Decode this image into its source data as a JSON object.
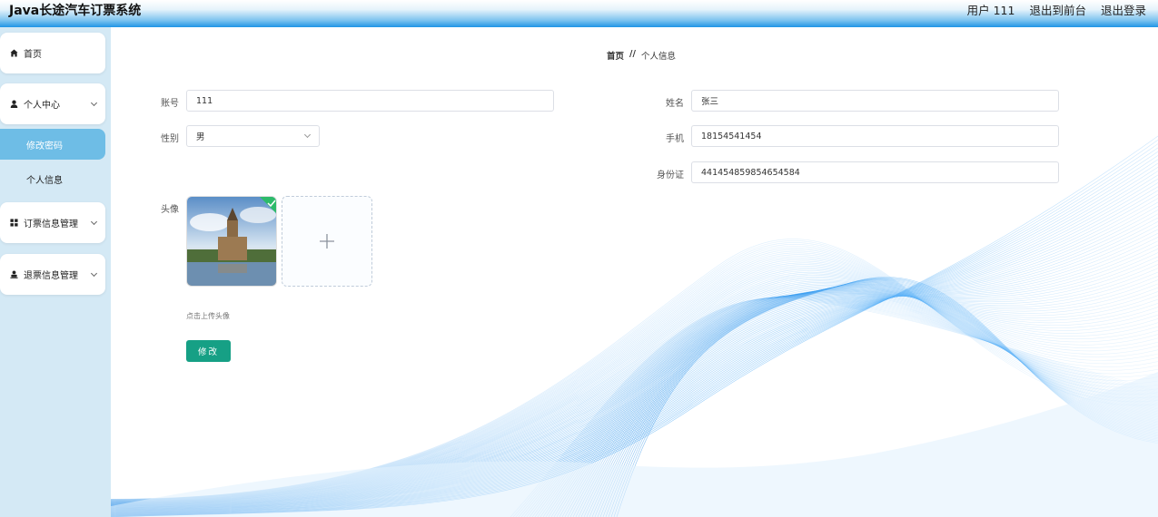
{
  "app": {
    "title": "Java长途汽车订票系统",
    "user_label": "用户 111",
    "back_to_front": "退出到前台",
    "logout": "退出登录"
  },
  "sidebar": {
    "home": "首页",
    "personal_center": "个人中心",
    "change_password": "修改密码",
    "personal_info": "个人信息",
    "ticket_management": "订票信息管理",
    "refund_management": "退票信息管理"
  },
  "breadcrumb": {
    "home": "首页",
    "separator": "//",
    "current": "个人信息"
  },
  "form": {
    "account_label": "账号",
    "account_value": "111",
    "gender_label": "性别",
    "gender_value": "男",
    "name_label": "姓名",
    "name_value": "张三",
    "phone_label": "手机",
    "phone_value": "18154541454",
    "id_label": "身份证",
    "id_value": "441454859854654584",
    "avatar_label": "头像",
    "upload_hint": "点击上传头像",
    "submit_label": "修改"
  },
  "icons": {
    "home": "home-icon",
    "user": "user-icon",
    "grid": "grid-icon",
    "person": "person-icon",
    "chevron": "chevron-down-icon",
    "plus": "plus-icon",
    "check": "check-icon"
  },
  "colors": {
    "accent": "#6ebde6",
    "button": "#16a085",
    "sidebar_bg": "#d4e9f5",
    "wave": "#1e88e5"
  }
}
